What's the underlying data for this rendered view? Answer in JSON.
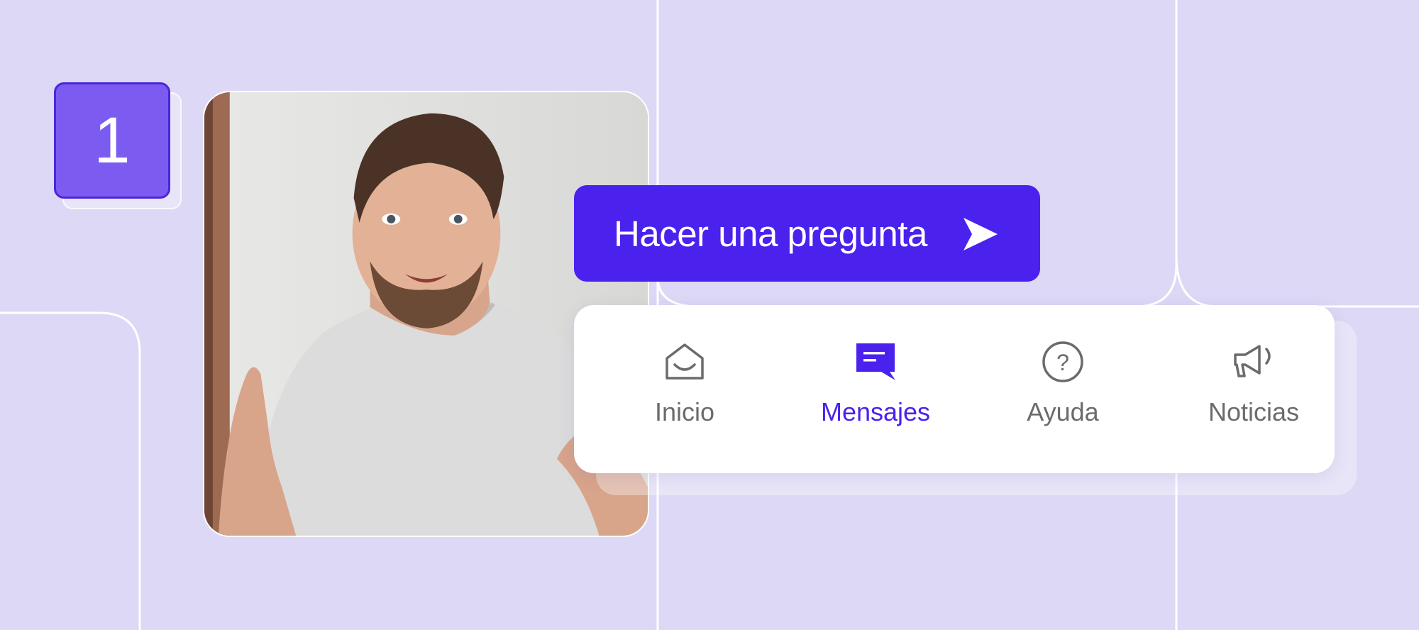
{
  "badge": {
    "number": "1"
  },
  "cta": {
    "label": "Hacer una pregunta",
    "icon": "send-arrow-icon"
  },
  "nav": {
    "items": [
      {
        "label": "Inicio",
        "icon": "home-envelope-icon",
        "active": false
      },
      {
        "label": "Mensajes",
        "icon": "message-icon",
        "active": true
      },
      {
        "label": "Ayuda",
        "icon": "help-icon",
        "active": false
      },
      {
        "label": "Noticias",
        "icon": "megaphone-icon",
        "active": false
      }
    ]
  },
  "colors": {
    "background": "#ddd8f5",
    "accent": "#4b21ee",
    "badge": "#7c5cf0",
    "inactive_text": "#6b6b6b",
    "card": "#ffffff"
  }
}
